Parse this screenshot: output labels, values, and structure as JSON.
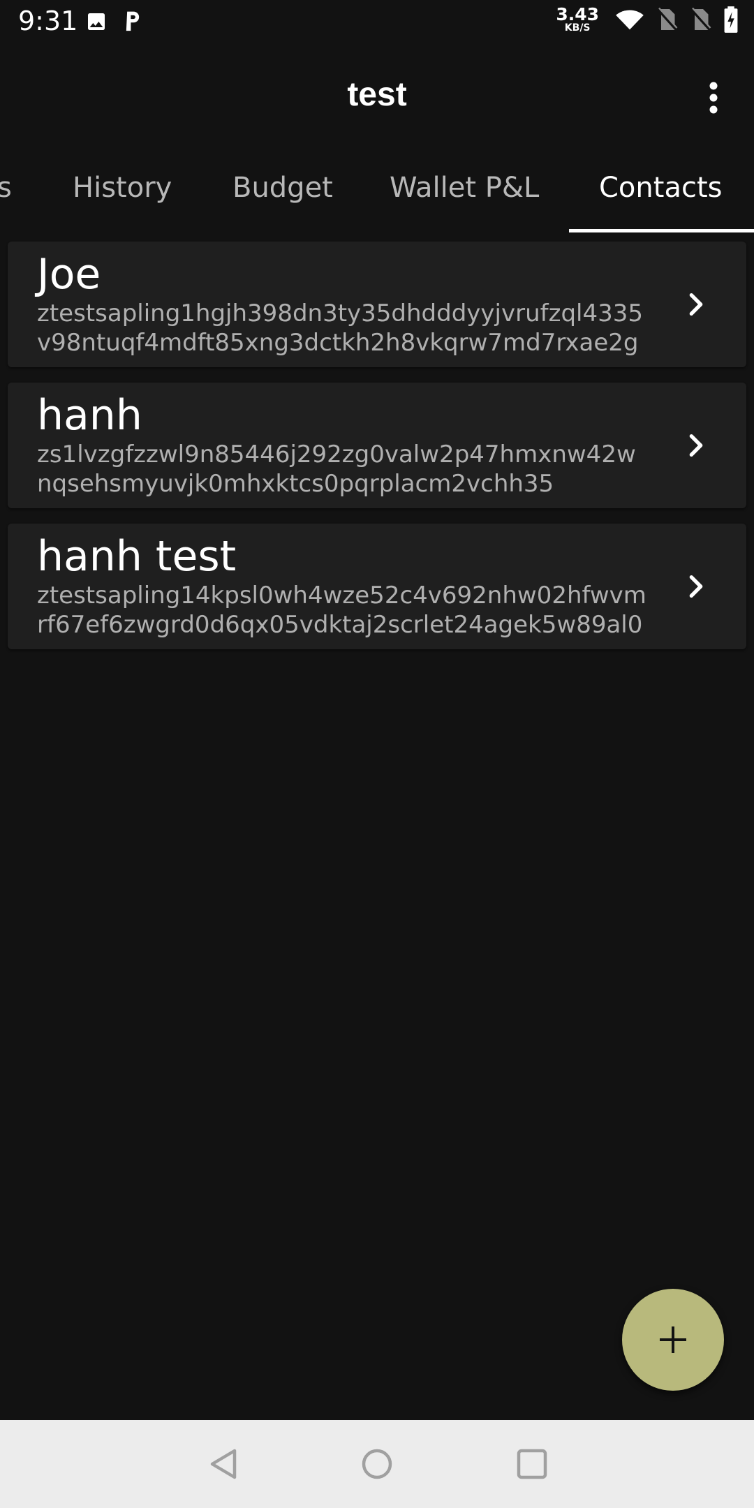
{
  "status_bar": {
    "time": "9:31",
    "net_speed_value": "3.43",
    "net_speed_unit": "KB/S",
    "icons": [
      "image-icon",
      "parking-icon",
      "wifi-icon",
      "no-sim-icon",
      "no-sim-icon",
      "battery-charging-icon"
    ]
  },
  "app_bar": {
    "title": "test",
    "menu_icon": "more-vert-icon"
  },
  "tabs": [
    {
      "label": "s",
      "active": false
    },
    {
      "label": "History",
      "active": false
    },
    {
      "label": "Budget",
      "active": false
    },
    {
      "label": "Wallet P&L",
      "active": false
    },
    {
      "label": "Contacts",
      "active": true
    }
  ],
  "contacts": [
    {
      "name": "Joe",
      "address": "ztestsapling1hgjh398dn3ty35dhdddyyjvrufzql4335v98ntuqf4mdft85xng3dctkh2h8vkqrw7md7rxae2g"
    },
    {
      "name": "hanh",
      "address": "zs1lvzgfzzwl9n85446j292zg0valw2p47hmxnw42wnqsehsmyuvjk0mhxktcs0pqrplacm2vchh35"
    },
    {
      "name": "hanh test",
      "address": "ztestsapling14kpsl0wh4wze52c4v692nhw02hfwvmrf67ef6zwgrd0d6qx05vdktaj2scrlet24agek5w89al0"
    }
  ],
  "fab": {
    "icon": "plus-icon",
    "color": "#b8b97c"
  },
  "nav_bar": {
    "icons": [
      "back-icon",
      "home-icon",
      "recents-icon"
    ]
  },
  "colors": {
    "background": "#121212",
    "card": "#1f1f1f",
    "accent": "#b8b97c"
  }
}
